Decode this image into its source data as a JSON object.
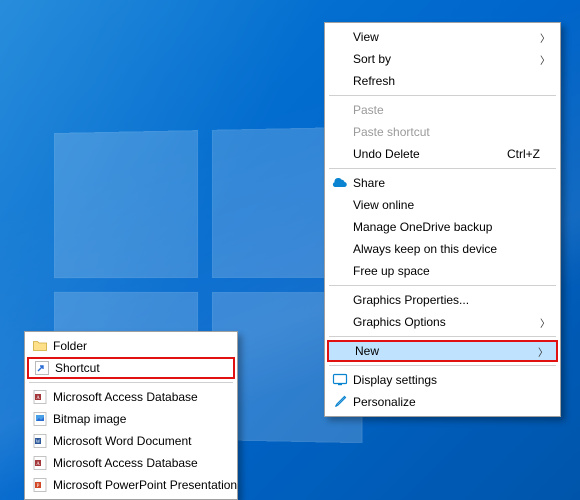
{
  "primary_menu": {
    "view": "View",
    "sort_by": "Sort by",
    "refresh": "Refresh",
    "paste": "Paste",
    "paste_shortcut": "Paste shortcut",
    "undo_delete": "Undo Delete",
    "undo_delete_shortcut": "Ctrl+Z",
    "share": "Share",
    "view_online": "View online",
    "manage_onedrive": "Manage OneDrive backup",
    "always_keep": "Always keep on this device",
    "free_up": "Free up space",
    "graphics_props": "Graphics Properties...",
    "graphics_options": "Graphics Options",
    "new": "New",
    "display_settings": "Display settings",
    "personalize": "Personalize"
  },
  "new_submenu": {
    "folder": "Folder",
    "shortcut": "Shortcut",
    "access_db": "Microsoft Access Database",
    "bitmap": "Bitmap image",
    "word": "Microsoft Word Document",
    "access_db2": "Microsoft Access Database",
    "ppt": "Microsoft PowerPoint Presentation"
  }
}
